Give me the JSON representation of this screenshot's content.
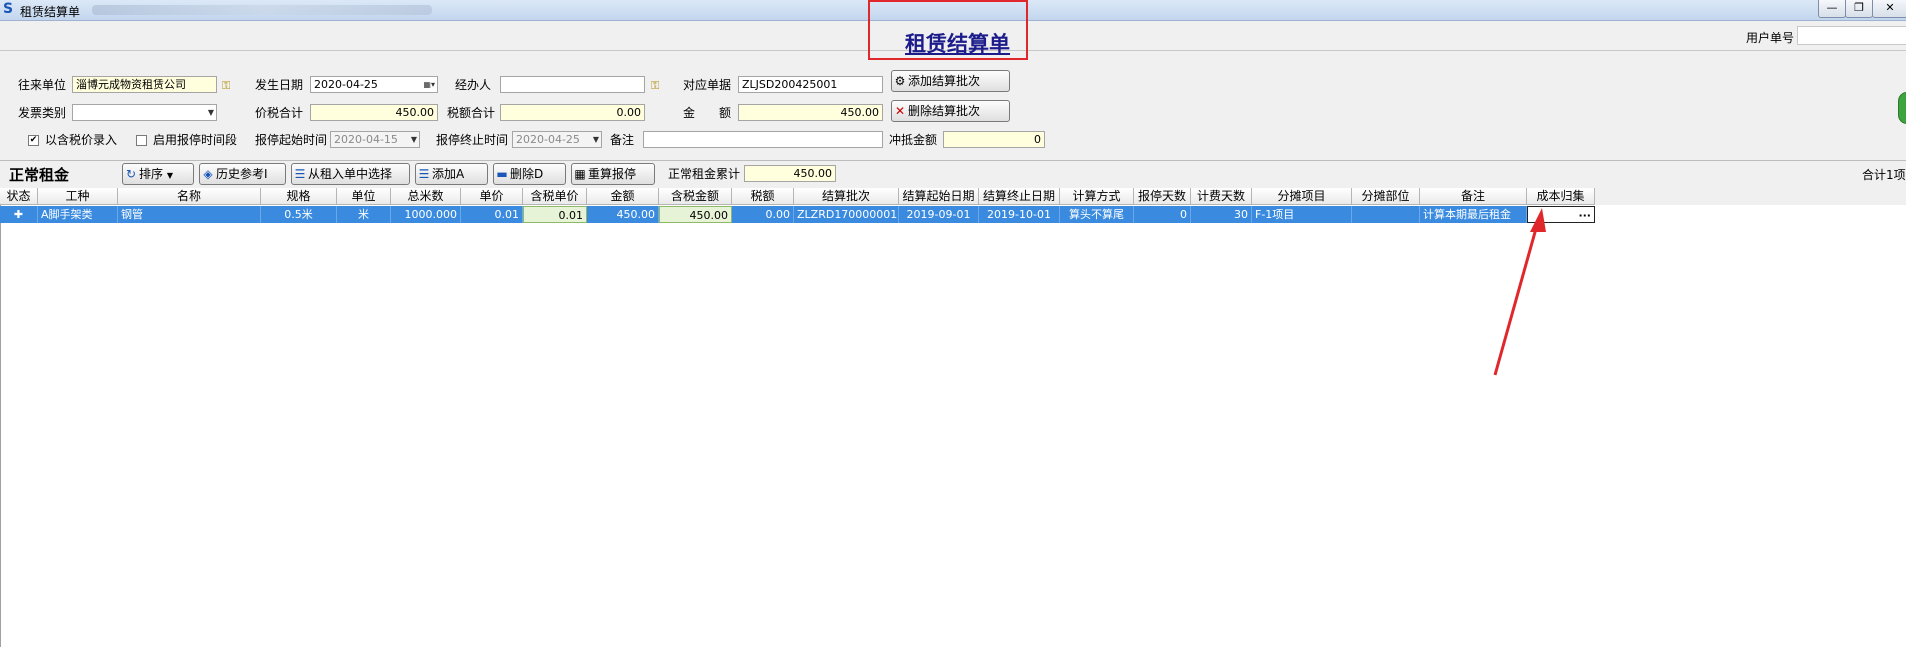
{
  "window": {
    "title": "租赁结算单",
    "buttons": [
      "—",
      "❐",
      "✕"
    ]
  },
  "page": {
    "heading": "租赁结算单",
    "user_no_label": "用户单号",
    "user_no_value": ""
  },
  "form": {
    "partner_label": "往来单位",
    "partner_value": "淄博元成物资租赁公司",
    "date_label": "发生日期",
    "date_value": "2020-04-25",
    "handler_label": "经办人",
    "handler_value": "",
    "doc_label": "对应单据",
    "doc_value": "ZLJSD200425001",
    "invoice_type_label": "发票类别",
    "invoice_type_value": "",
    "tax_total_label": "价税合计",
    "tax_total_value": "450.00",
    "tax_amount_label": "税额合计",
    "tax_amount_value": "0.00",
    "amount_label": "金　　额",
    "amount_value": "450.00",
    "include_tax_label": "以含税价录入",
    "include_tax_checked": true,
    "enable_period_label": "启用报停时间段",
    "enable_period_checked": false,
    "stop_start_label": "报停起始时间",
    "stop_start_value": "2020-04-15",
    "stop_end_label": "报停终止时间",
    "stop_end_value": "2020-04-25",
    "remark_label": "备注",
    "remark_value": "",
    "offset_label": "冲抵金额",
    "offset_value": "0"
  },
  "buttons": {
    "add_batch": "添加结算批次",
    "delete_batch": "删除结算批次"
  },
  "section": {
    "title": "正常租金",
    "sort": "排序",
    "history": "历史参考I",
    "select_from": "从租入单中选择",
    "add": "添加A",
    "delete": "删除D",
    "recalc": "重算报停",
    "rent_total_label": "正常租金累计",
    "rent_total_value": "450.00",
    "right_total": "合计1项"
  },
  "table": {
    "columns": [
      "状态",
      "工种",
      "名称",
      "规格",
      "单位",
      "总米数",
      "单价",
      "含税单价",
      "金额",
      "含税金额",
      "税额",
      "结算批次",
      "结算起始日期",
      "结算终止日期",
      "计算方式",
      "报停天数",
      "计费天数",
      "分摊项目",
      "分摊部位",
      "备注",
      "成本归集"
    ],
    "rows": [
      {
        "status": "✚",
        "type": "A脚手架类",
        "name": "钢管",
        "spec": "0.5米",
        "unit": "米",
        "total_m": "1000.000",
        "price": "0.01",
        "tax_price": "0.01",
        "amount": "450.00",
        "tax_amount_total": "450.00",
        "tax": "0.00",
        "batch": "ZLZRD170000001",
        "start": "2019-09-01",
        "end": "2019-10-01",
        "method": "算头不算尾",
        "stop_days": "0",
        "bill_days": "30",
        "project": "F-1项目",
        "part": "",
        "remark": "计算本期最后租金",
        "cost": ""
      }
    ]
  },
  "colors": {
    "accent_red": "#e0282c",
    "selected_row": "#3a8be0",
    "heading": "#1c1c8c"
  }
}
